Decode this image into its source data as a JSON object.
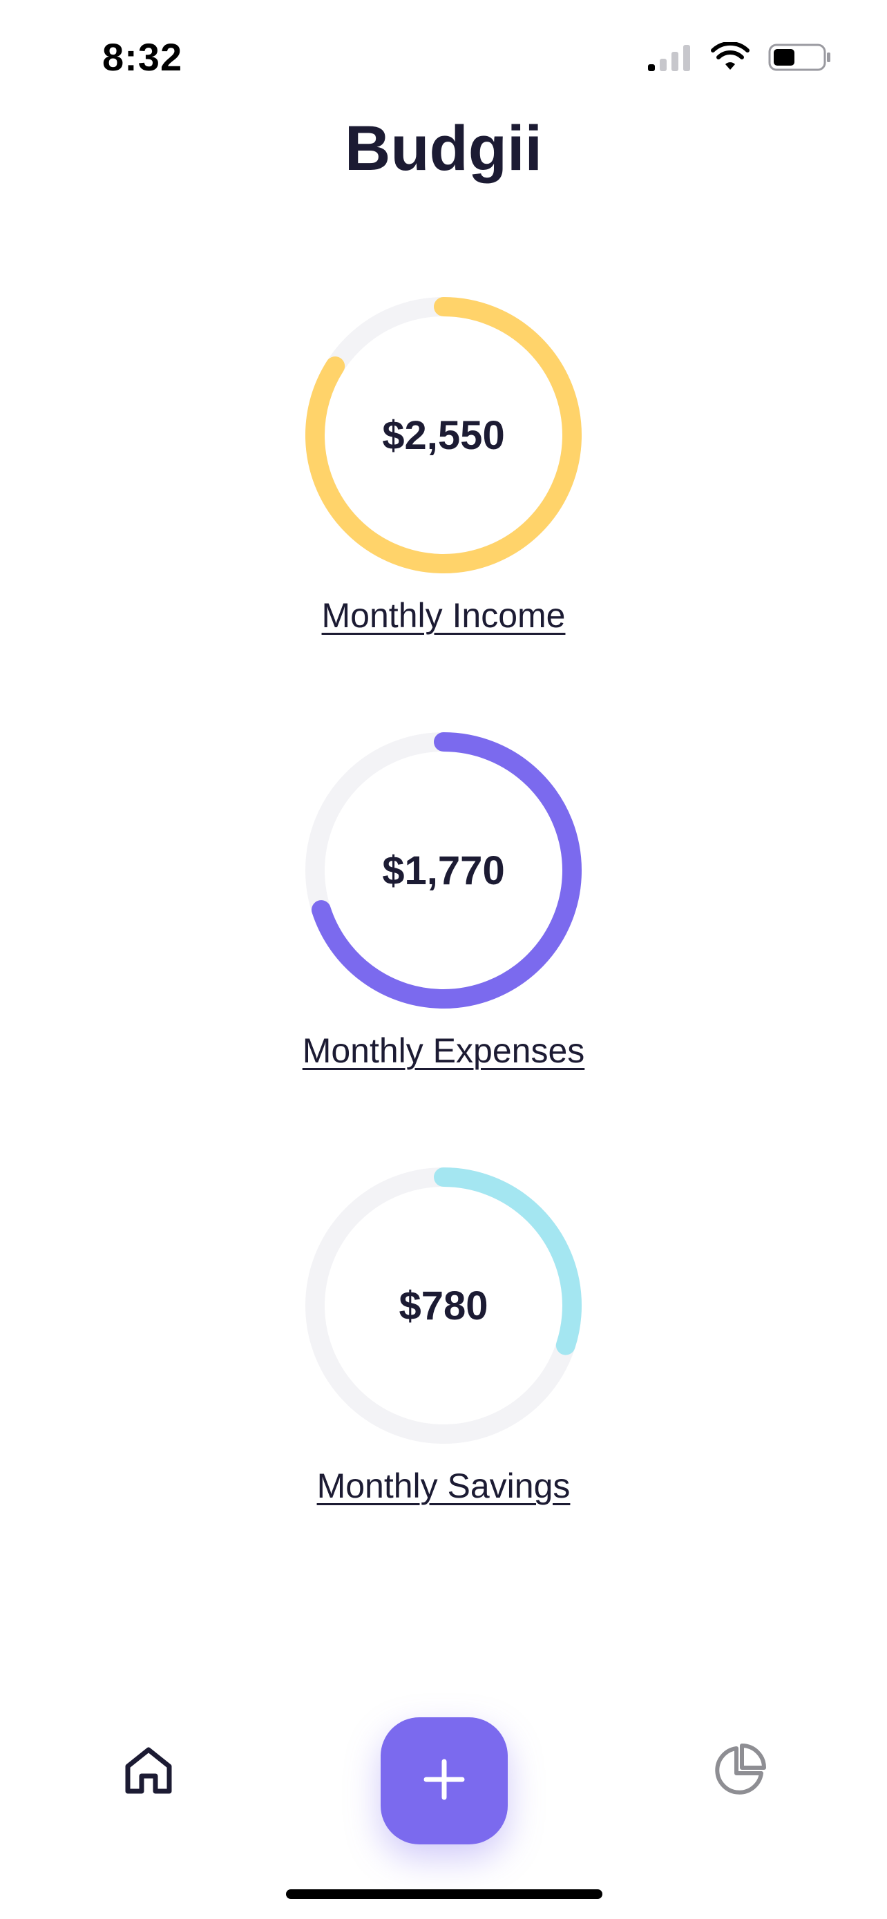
{
  "status_bar": {
    "time": "8:32",
    "icons": [
      "cellular-signal-icon",
      "wifi-icon",
      "battery-icon"
    ]
  },
  "app": {
    "title": "Budgii"
  },
  "summaries": [
    {
      "label": "Monthly Income",
      "amount": "$2,550",
      "progress": 0.84,
      "color": "#ffd36a",
      "icon": "ring-progress"
    },
    {
      "label": "Monthly Expenses",
      "amount": "$1,770",
      "progress": 0.7,
      "color": "#7b6aee",
      "icon": "ring-progress"
    },
    {
      "label": "Monthly Savings",
      "amount": "$780",
      "progress": 0.3,
      "color": "#a4e6f1",
      "icon": "ring-progress"
    }
  ],
  "colors": {
    "track": "#f3f3f6",
    "text": "#1c1b33",
    "accent": "#7b6aee"
  },
  "bottom_nav": {
    "items": [
      {
        "icon": "home-icon"
      },
      {
        "icon": "plus-icon"
      },
      {
        "icon": "pie-chart-icon"
      }
    ]
  }
}
